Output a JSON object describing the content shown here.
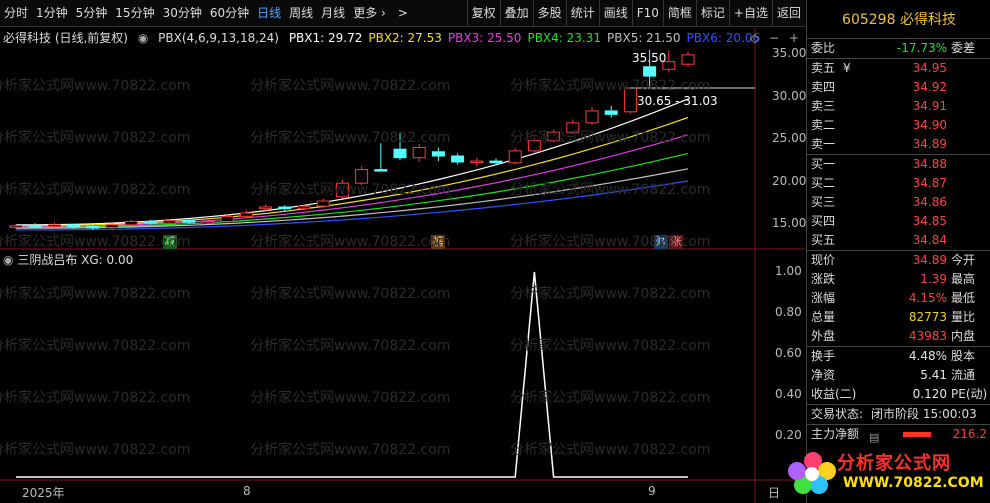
{
  "toolbar": {
    "periods": [
      "分时",
      "1分钟",
      "5分钟",
      "15分钟",
      "30分钟",
      "60分钟",
      "日线",
      "周线",
      "月线",
      "更多 ›"
    ],
    "active_period": "日线",
    "right_items": [
      "复权",
      "叠加",
      "多股",
      "统计",
      "画线",
      "F10",
      "简框",
      "标记",
      "+自选",
      "返回"
    ]
  },
  "chart": {
    "stock_title": "必得科技 (日线,前复权)",
    "indicator_name": "PBX(4,6,9,13,18,24)",
    "pbx": [
      {
        "label": "PBX1: 29.72",
        "color": "#ffffff"
      },
      {
        "label": "PBX2: 27.53",
        "color": "#f0e020"
      },
      {
        "label": "PBX3: 25.50",
        "color": "#e040e0"
      },
      {
        "label": "PBX4: 23.31",
        "color": "#20e020"
      },
      {
        "label": "PBX5: 21.50",
        "color": "#c0c0c0"
      },
      {
        "label": "PBX6: 20.06",
        "color": "#3050ff"
      }
    ],
    "y_ticks": [
      "35.00",
      "30.00",
      "25.00",
      "20.00",
      "15.00"
    ],
    "high_label": "35.50",
    "range_label": "30.65 - 31.03",
    "markers": [
      {
        "text": "减",
        "bg": "#1a5a1a",
        "color": "#7fff7f"
      },
      {
        "text": "榜",
        "bg": "#5a3a1a",
        "color": "#ffd080"
      },
      {
        "text": "财",
        "bg": "#1a3a5a",
        "color": "#a0d0ff"
      },
      {
        "text": "涨",
        "bg": "#5a1a1a",
        "color": "#ff8080"
      }
    ],
    "sub_indicator": "三阴战吕布  XG: 0.00",
    "sub_y_ticks": [
      "1.00",
      "0.80",
      "0.60",
      "0.40",
      "0.20"
    ],
    "x_labels": [
      "2025年",
      "8",
      "9"
    ],
    "x_right_label": "日",
    "watermark": "分析家公式网www.70822.com"
  },
  "candles": [
    {
      "o": 14.6,
      "c": 14.8,
      "h": 15.0,
      "l": 14.4
    },
    {
      "o": 14.8,
      "c": 14.7,
      "h": 15.1,
      "l": 14.5
    },
    {
      "o": 14.7,
      "c": 14.9,
      "h": 15.2,
      "l": 14.5
    },
    {
      "o": 14.9,
      "c": 14.7,
      "h": 15.0,
      "l": 14.4
    },
    {
      "o": 14.7,
      "c": 14.6,
      "h": 14.9,
      "l": 14.3
    },
    {
      "o": 14.6,
      "c": 14.9,
      "h": 15.1,
      "l": 14.4
    },
    {
      "o": 14.9,
      "c": 15.3,
      "h": 15.5,
      "l": 14.8
    },
    {
      "o": 15.3,
      "c": 15.1,
      "h": 15.5,
      "l": 14.9
    },
    {
      "o": 15.1,
      "c": 15.4,
      "h": 15.6,
      "l": 15.0
    },
    {
      "o": 15.4,
      "c": 15.2,
      "h": 15.6,
      "l": 15.0
    },
    {
      "o": 15.2,
      "c": 15.3,
      "h": 15.5,
      "l": 15.0
    },
    {
      "o": 15.3,
      "c": 15.9,
      "h": 16.2,
      "l": 15.1
    },
    {
      "o": 15.9,
      "c": 16.3,
      "h": 16.6,
      "l": 15.7
    },
    {
      "o": 16.8,
      "c": 17.0,
      "h": 17.3,
      "l": 16.5
    },
    {
      "o": 17.0,
      "c": 16.8,
      "h": 17.2,
      "l": 16.5
    },
    {
      "o": 16.8,
      "c": 17.1,
      "h": 17.3,
      "l": 16.6
    },
    {
      "o": 17.1,
      "c": 17.7,
      "h": 18.0,
      "l": 16.9
    },
    {
      "o": 18.2,
      "c": 19.8,
      "h": 20.2,
      "l": 18.0
    },
    {
      "o": 19.8,
      "c": 21.4,
      "h": 21.8,
      "l": 19.6
    },
    {
      "o": 21.4,
      "c": 21.3,
      "h": 24.5,
      "l": 21.3
    },
    {
      "o": 23.8,
      "c": 22.8,
      "h": 25.7,
      "l": 22.5
    },
    {
      "o": 22.8,
      "c": 24.0,
      "h": 24.4,
      "l": 22.3
    },
    {
      "o": 23.5,
      "c": 23.0,
      "h": 24.0,
      "l": 22.4
    },
    {
      "o": 23.0,
      "c": 22.3,
      "h": 23.3,
      "l": 22.0
    },
    {
      "o": 22.3,
      "c": 22.4,
      "h": 22.8,
      "l": 21.8
    },
    {
      "o": 22.4,
      "c": 22.2,
      "h": 22.7,
      "l": 21.9
    },
    {
      "o": 22.2,
      "c": 23.6,
      "h": 23.9,
      "l": 22.0
    },
    {
      "o": 23.6,
      "c": 24.8,
      "h": 25.2,
      "l": 23.4
    },
    {
      "o": 24.8,
      "c": 25.8,
      "h": 26.1,
      "l": 24.6
    },
    {
      "o": 25.8,
      "c": 26.9,
      "h": 27.3,
      "l": 25.6
    },
    {
      "o": 26.9,
      "c": 28.3,
      "h": 28.8,
      "l": 26.7
    },
    {
      "o": 28.3,
      "c": 27.9,
      "h": 28.9,
      "l": 27.5
    },
    {
      "o": 28.2,
      "c": 31.0,
      "h": 31.0,
      "l": 28.0
    },
    {
      "o": 33.5,
      "c": 32.4,
      "h": 35.5,
      "l": 31.2
    },
    {
      "o": 33.2,
      "c": 34.1,
      "h": 35.4,
      "l": 32.8
    },
    {
      "o": 33.8,
      "c": 34.9,
      "h": 35.3,
      "l": 33.5
    }
  ],
  "ma_lines": [
    {
      "color": "#ffffff",
      "start": 14.9,
      "end": 29.72
    },
    {
      "color": "#f0e020",
      "start": 14.8,
      "end": 27.53
    },
    {
      "color": "#e040e0",
      "start": 14.7,
      "end": 25.5
    },
    {
      "color": "#20e020",
      "start": 14.6,
      "end": 23.31
    },
    {
      "color": "#c0c0c0",
      "start": 14.5,
      "end": 21.5
    },
    {
      "color": "#3050ff",
      "start": 14.3,
      "end": 20.06
    }
  ],
  "signal": [
    0,
    0,
    0,
    0,
    0,
    0,
    0,
    0,
    0,
    0,
    0,
    0,
    0,
    0,
    0,
    0,
    0,
    0,
    0,
    0,
    0,
    0,
    0,
    0,
    0,
    0,
    0,
    1,
    0,
    0,
    0,
    0,
    0,
    0,
    0,
    0
  ],
  "panel": {
    "code_name": "605298 必得科技",
    "weibi_label": "委比",
    "weibi_value": "-17.73%",
    "weicha_label": "委差",
    "sells": [
      {
        "label": "卖五",
        "mark": "¥",
        "price": "34.95"
      },
      {
        "label": "卖四",
        "mark": "",
        "price": "34.92"
      },
      {
        "label": "卖三",
        "mark": "",
        "price": "34.91"
      },
      {
        "label": "卖二",
        "mark": "",
        "price": "34.90"
      },
      {
        "label": "卖一",
        "mark": "",
        "price": "34.89"
      }
    ],
    "buys": [
      {
        "label": "买一",
        "price": "34.88"
      },
      {
        "label": "买二",
        "price": "34.87"
      },
      {
        "label": "买三",
        "price": "34.86"
      },
      {
        "label": "买四",
        "price": "34.85"
      },
      {
        "label": "买五",
        "price": "34.84"
      }
    ],
    "quote": [
      {
        "l": "现价",
        "v": "34.89",
        "vc": "red",
        "r": "今开"
      },
      {
        "l": "涨跌",
        "v": "1.39",
        "vc": "red",
        "r": "最高"
      },
      {
        "l": "涨幅",
        "v": "4.15%",
        "vc": "red",
        "r": "最低"
      },
      {
        "l": "总量",
        "v": "82773",
        "vc": "yellow",
        "r": "量比"
      },
      {
        "l": "外盘",
        "v": "43983",
        "vc": "red",
        "r": "内盘"
      }
    ],
    "fund": [
      {
        "l": "换手",
        "v": "4.48%",
        "r": "股本"
      },
      {
        "l": "净资",
        "v": "5.41",
        "r": "流通"
      },
      {
        "l": "收益(二)",
        "v": "0.120",
        "r": "PE(动)"
      }
    ],
    "status_label": "交易状态:",
    "status_value": "闭市阶段 15:00:03",
    "net_label": "主力净额",
    "net_value": "216.2"
  },
  "logo": {
    "line1": "分析家公式网",
    "line2": "WWW.70822.COM"
  }
}
